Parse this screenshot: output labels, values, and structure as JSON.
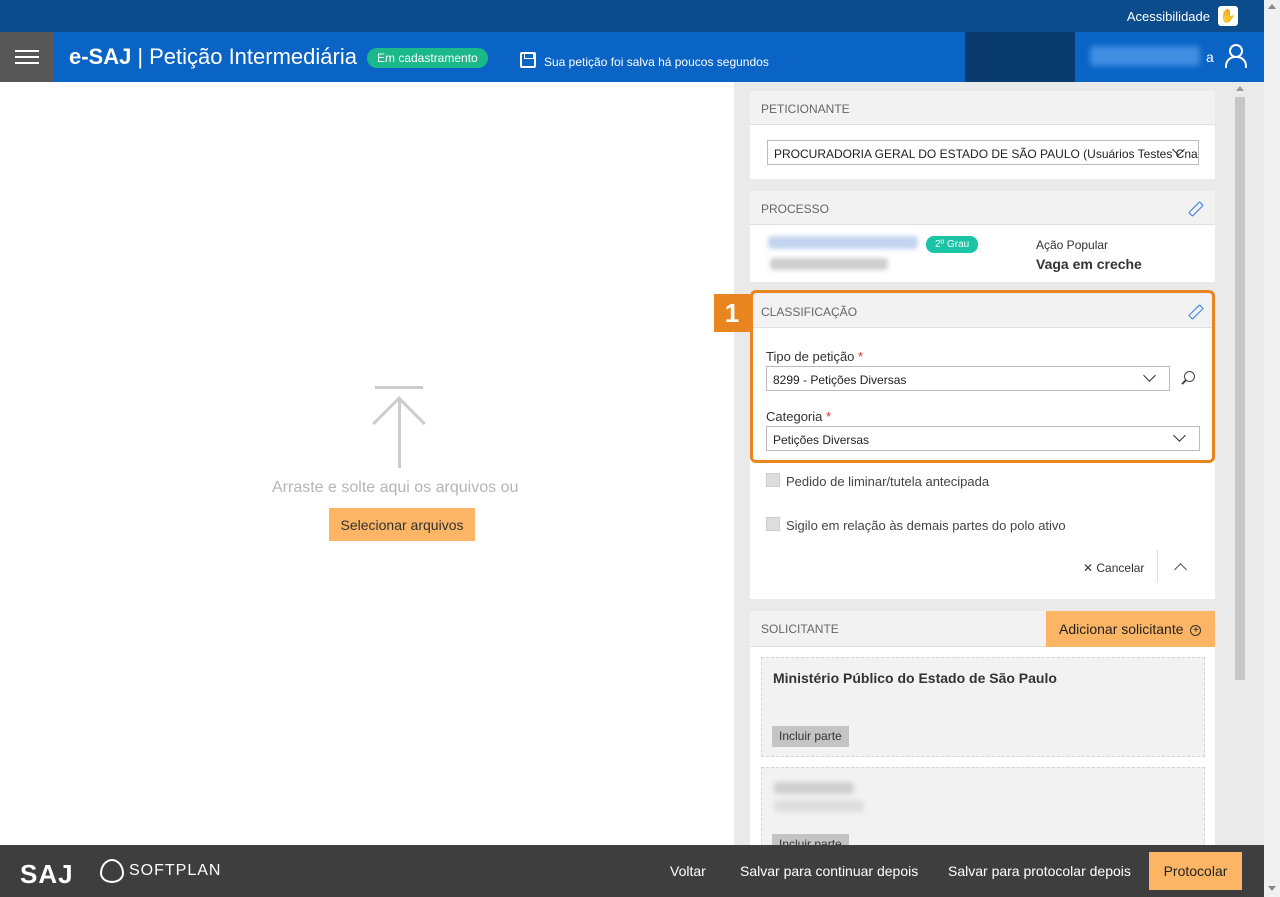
{
  "accessibility": {
    "label": "Acessibilidade"
  },
  "header": {
    "brand": "e-SAJ",
    "title": "Petição Intermediária",
    "status_badge": "Em cadastramento",
    "save_message": "Sua petição foi salva há poucos segundos",
    "user_suffix": "a"
  },
  "dropzone": {
    "text": "Arraste e solte aqui os arquivos ou",
    "select_button": "Selecionar arquivos"
  },
  "peticionante": {
    "heading": "PETICIONANTE",
    "selected": "PROCURADORIA GERAL DO ESTADO DE SÃO PAULO (Usuários Testes Cna -"
  },
  "processo": {
    "heading": "PROCESSO",
    "grau_badge": "2º Grau",
    "classe": "Ação Popular",
    "assunto": "Vaga em creche"
  },
  "classificacao": {
    "step_number": "1",
    "heading": "CLASSIFICAÇÃO",
    "tipo_label": "Tipo de petição",
    "tipo_value": "8299 - Petições Diversas",
    "categoria_label": "Categoria",
    "categoria_value": "Petições Diversas",
    "required_mark": "*",
    "checkbox_liminar": "Pedido de liminar/tutela antecipada",
    "checkbox_sigilo": "Sigilo em relação às demais partes do polo ativo",
    "cancel_label": "Cancelar",
    "highlight_color": "#e8851f"
  },
  "solicitante": {
    "heading": "SOLICITANTE",
    "add_button": "Adicionar solicitante",
    "cards": [
      {
        "name": "Ministério Público do Estado de São Paulo",
        "include_button": "Incluir parte"
      },
      {
        "name": "",
        "include_button": "Incluir parte"
      }
    ]
  },
  "footer": {
    "saj_logo": "SAJ",
    "softplan_logo": "SOFTPLAN",
    "back": "Voltar",
    "save_continue": "Salvar para continuar depois",
    "save_protocol": "Salvar para protocolar depois",
    "protocol": "Protocolar"
  },
  "colors": {
    "header_blue": "#0a64c6",
    "top_bar": "#0b4c8c",
    "accent_orange": "#fbb565",
    "badge_green": "#1bb98a"
  }
}
